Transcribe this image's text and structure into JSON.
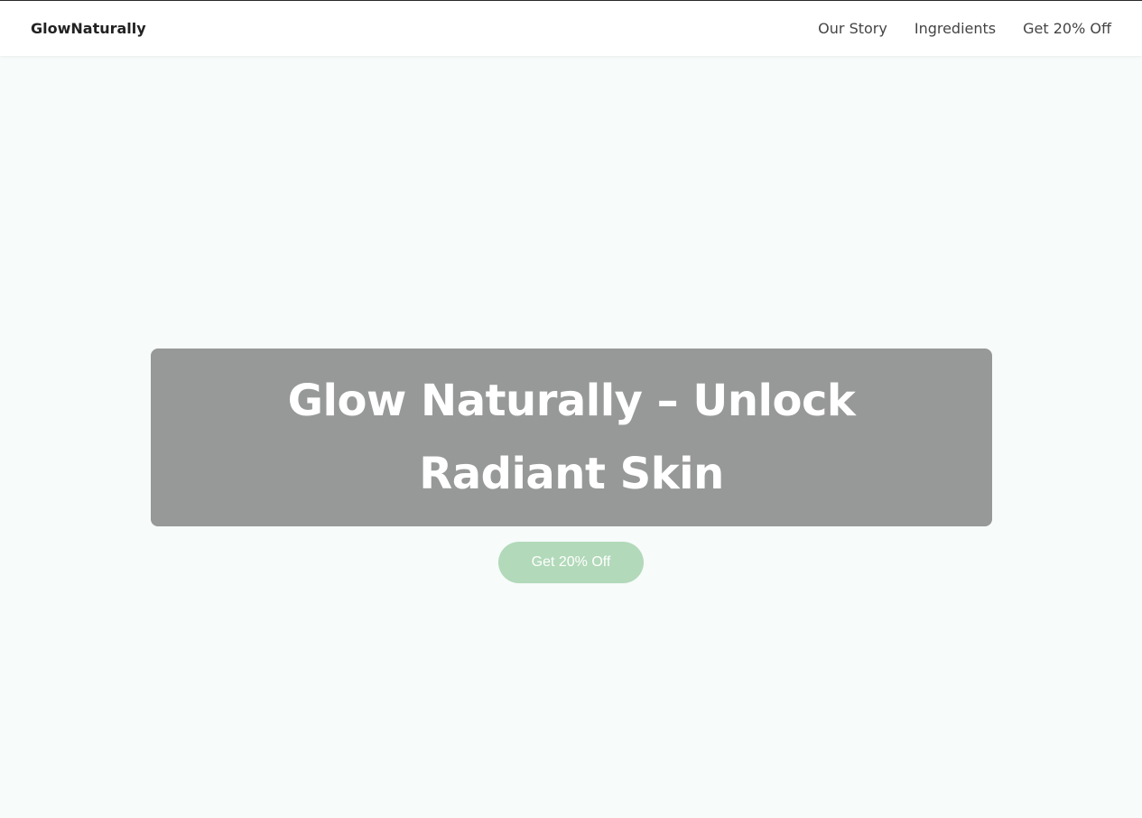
{
  "header": {
    "brand": "GlowNaturally",
    "nav": [
      {
        "label": "Our Story"
      },
      {
        "label": "Ingredients"
      },
      {
        "label": "Get 20% Off"
      }
    ]
  },
  "hero": {
    "title": "Glow Naturally – Unlock Radiant Skin",
    "cta_label": "Get 20% Off"
  },
  "colors": {
    "page_background": "#f7fbfa",
    "hero_panel": "#979998",
    "cta_background": "#b2d9b9",
    "text_dark": "#222222"
  }
}
